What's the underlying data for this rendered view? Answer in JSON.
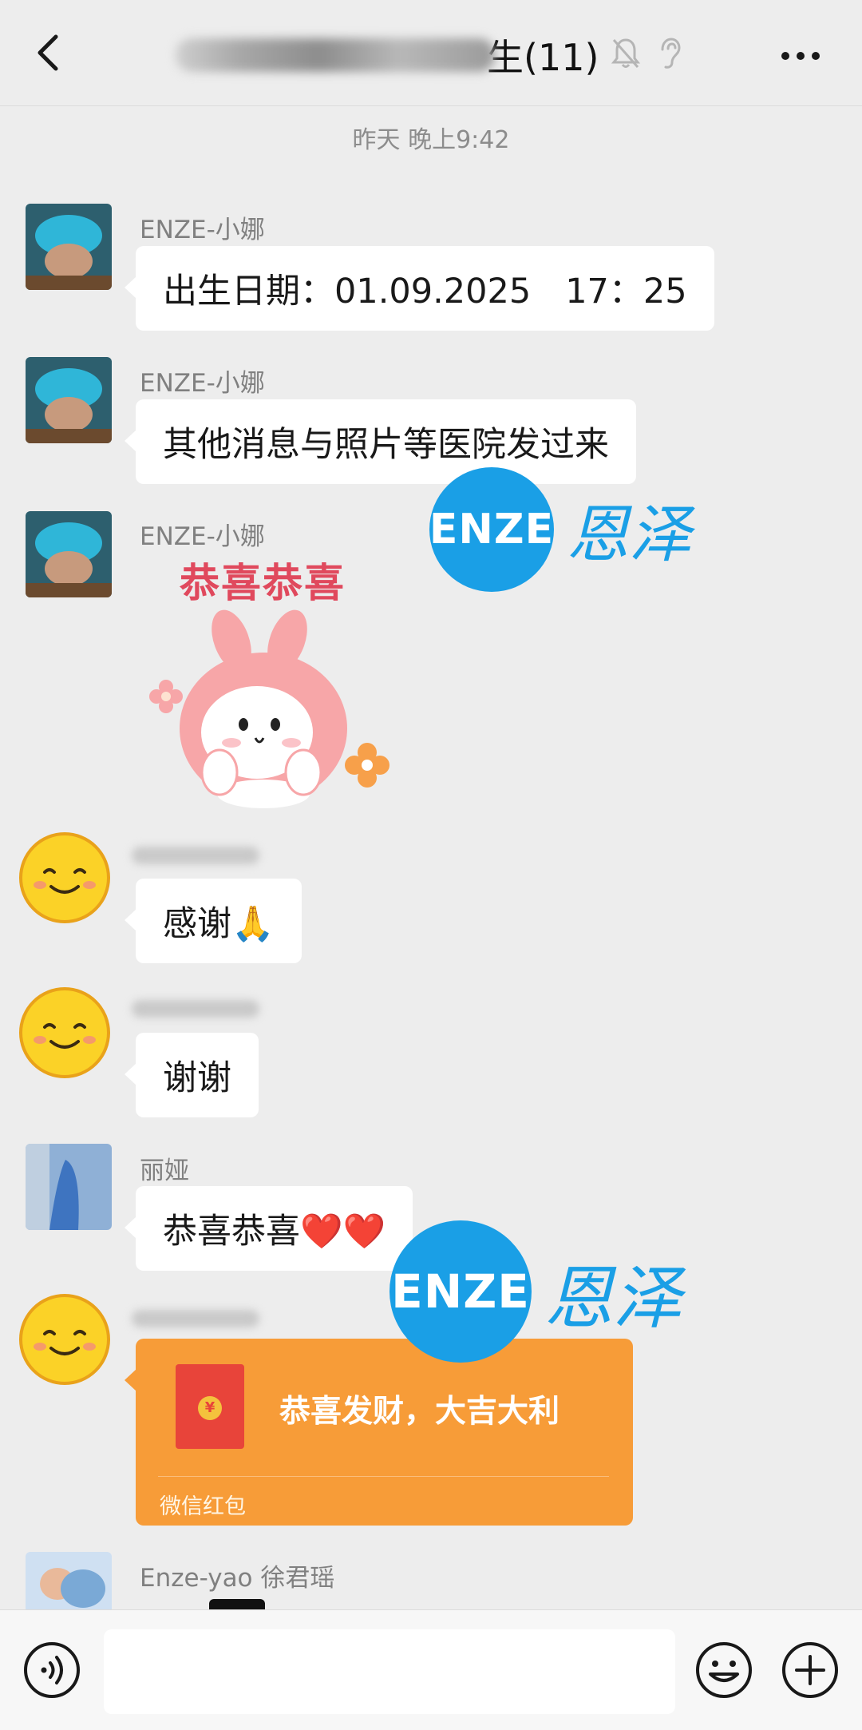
{
  "header": {
    "title": "生(11)"
  },
  "timestamp": "昨天 晚上9:42",
  "messages": [
    {
      "sender": "ENZE-小娜",
      "text": "出生日期：01.09.2025　17：25"
    },
    {
      "sender": "ENZE-小娜",
      "text": "其他消息与照片等医院发过来"
    },
    {
      "sender": "ENZE-小娜",
      "sticker_text": "恭喜恭喜"
    },
    {
      "sender": "",
      "text": "感谢🙏"
    },
    {
      "sender": "",
      "text": "谢谢"
    },
    {
      "sender": "丽娅",
      "text": "恭喜恭喜❤️❤️"
    },
    {
      "sender": ""
    },
    {
      "sender": "Enze-yao 徐君瑶"
    }
  ],
  "red_packet": {
    "title": "恭喜发财，大吉大利",
    "footer": "微信红包"
  },
  "watermark": {
    "logo": "ENZE",
    "text": "恩泽"
  },
  "colors": {
    "accent": "#1a9fe6",
    "red_packet": "#f79c38",
    "background": "#ededed"
  },
  "icons": {
    "back": "chevron-left-icon",
    "mute": "bell-off-icon",
    "ear": "ear-icon",
    "more": "more-icon",
    "voice": "voice-icon",
    "emoji": "emoji-icon",
    "plus": "plus-icon"
  }
}
